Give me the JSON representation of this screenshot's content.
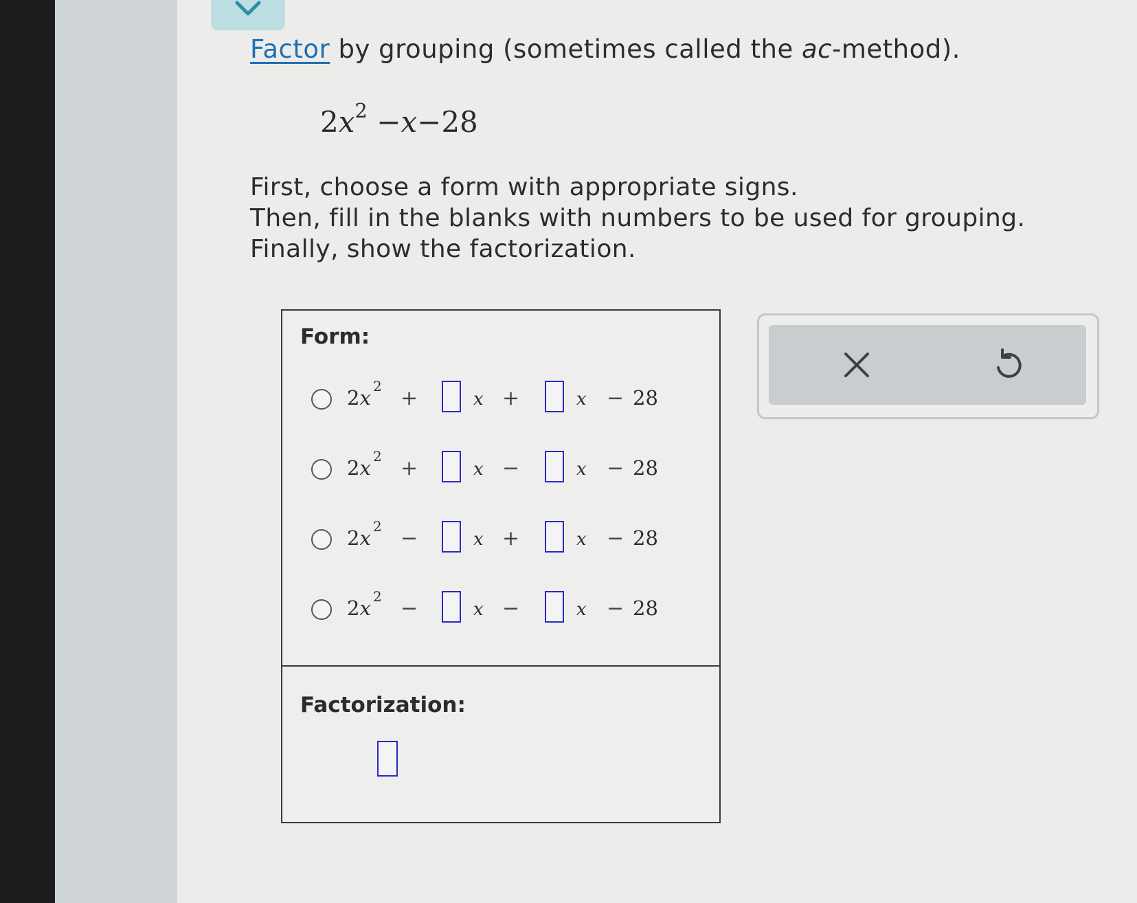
{
  "problem": {
    "link_text": "Factor",
    "prompt_rest_1": " by grouping (sometimes called the ",
    "prompt_ital": "ac",
    "prompt_rest_2": "-method).",
    "expression": {
      "coef": "2",
      "var": "x",
      "exp": "2",
      "rest_op1": "−",
      "rest_var": "x",
      "rest_op2": "−",
      "rest_const": "28"
    },
    "instructions": [
      "First, choose a form with appropriate signs.",
      "Then, fill in the blanks with numbers to be used for grouping.",
      "Finally, show the factorization."
    ]
  },
  "answer": {
    "form_label": "Form:",
    "options": [
      {
        "lead": "2",
        "var": "x",
        "exp": "2",
        "op1": "+",
        "x1": "x",
        "op2": "+",
        "x2": "x",
        "op3": "−",
        "const": "28",
        "selected": false
      },
      {
        "lead": "2",
        "var": "x",
        "exp": "2",
        "op1": "+",
        "x1": "x",
        "op2": "−",
        "x2": "x",
        "op3": "−",
        "const": "28",
        "selected": false
      },
      {
        "lead": "2",
        "var": "x",
        "exp": "2",
        "op1": "−",
        "x1": "x",
        "op2": "+",
        "x2": "x",
        "op3": "−",
        "const": "28",
        "selected": false
      },
      {
        "lead": "2",
        "var": "x",
        "exp": "2",
        "op1": "−",
        "x1": "x",
        "op2": "−",
        "x2": "x",
        "op3": "−",
        "const": "28",
        "selected": false
      }
    ],
    "factorization_label": "Factorization:",
    "blank_color": "#2a28c8"
  },
  "tools": {
    "clear_icon": "close-icon",
    "undo_icon": "undo-icon"
  },
  "colors": {
    "link": "#1f6fb2",
    "tab": "#bcdde2",
    "tool_bg": "#c9cdcf"
  }
}
